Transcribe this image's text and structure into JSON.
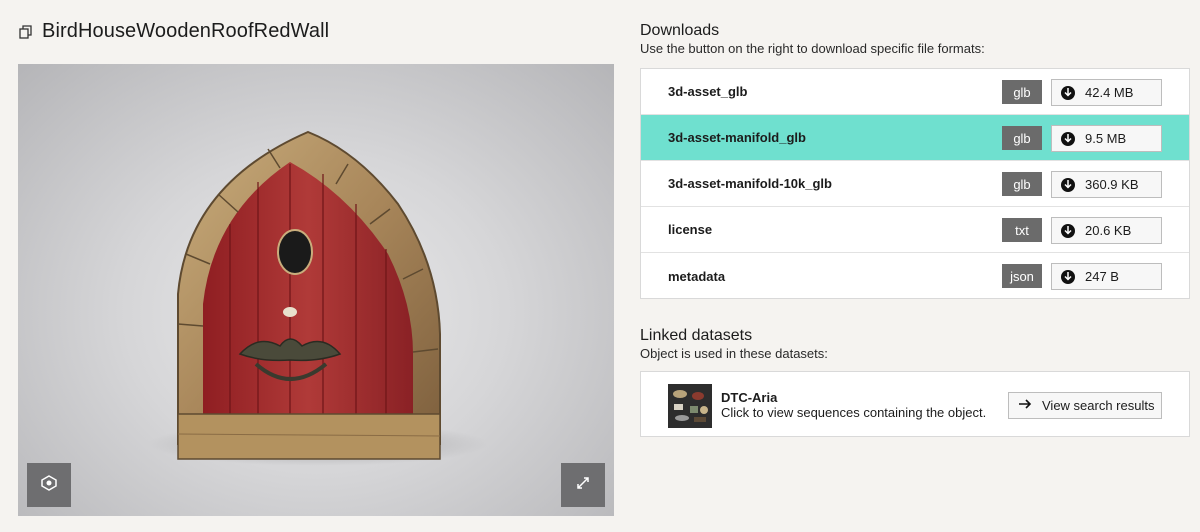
{
  "object": {
    "title": "BirdHouseWoodenRoofRedWall",
    "copy_icon": "copy-icon"
  },
  "viewer": {
    "reset_view_icon": "reset-view-icon",
    "fullscreen_icon": "expand-icon"
  },
  "downloads": {
    "title": "Downloads",
    "subtitle": "Use the button on the right to download specific file formats:",
    "rows": [
      {
        "name": "3d-asset_glb",
        "format": "glb",
        "size": "42.4 MB",
        "highlighted": false
      },
      {
        "name": "3d-asset-manifold_glb",
        "format": "glb",
        "size": "9.5 MB",
        "highlighted": true
      },
      {
        "name": "3d-asset-manifold-10k_glb",
        "format": "glb",
        "size": "360.9 KB",
        "highlighted": false
      },
      {
        "name": "license",
        "format": "txt",
        "size": "20.6 KB",
        "highlighted": false
      },
      {
        "name": "metadata",
        "format": "json",
        "size": "247 B",
        "highlighted": false
      }
    ],
    "highlight_color": "#6fe0cf",
    "download_icon": "download-arrow-icon"
  },
  "linked": {
    "title": "Linked datasets",
    "subtitle": "Object is used in these datasets:",
    "dataset_name": "DTC-Aria",
    "dataset_desc": "Click to view sequences containing the object.",
    "button_label": "View search results",
    "button_icon": "arrow-right-icon"
  }
}
